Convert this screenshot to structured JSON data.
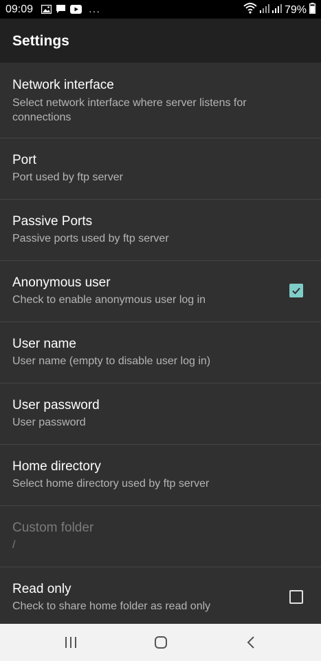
{
  "status_bar": {
    "time": "09:09",
    "battery": "79%",
    "overflow": "···"
  },
  "app_bar": {
    "title": "Settings"
  },
  "preferences": [
    {
      "title": "Network interface",
      "summary": "Select network interface where server listens for connections"
    },
    {
      "title": "Port",
      "summary": "Port used by ftp server"
    },
    {
      "title": "Passive Ports",
      "summary": "Passive ports used by ftp server"
    },
    {
      "title": "Anonymous user",
      "summary": "Check to enable anonymous user log in",
      "checked": true
    },
    {
      "title": "User name",
      "summary": "User name (empty to disable user log in)"
    },
    {
      "title": "User password",
      "summary": "User password"
    },
    {
      "title": "Home directory",
      "summary": "Select home directory used by ftp server"
    },
    {
      "title": "Custom folder",
      "summary": "/",
      "enabled": false
    },
    {
      "title": "Read only",
      "summary": "Check to share home folder as read only",
      "checked": false
    }
  ],
  "colors": {
    "background": "#303030",
    "app_bar": "#212121",
    "accent": "#7fcdc8",
    "nav_bar": "#f2f2f2"
  },
  "icons": {
    "status_left": [
      "gallery-icon",
      "message-icon",
      "youtube-icon"
    ],
    "status_right": [
      "wifi-icon",
      "signal-icon",
      "signal-icon"
    ],
    "nav": [
      "recents-icon",
      "home-icon",
      "back-icon"
    ]
  }
}
